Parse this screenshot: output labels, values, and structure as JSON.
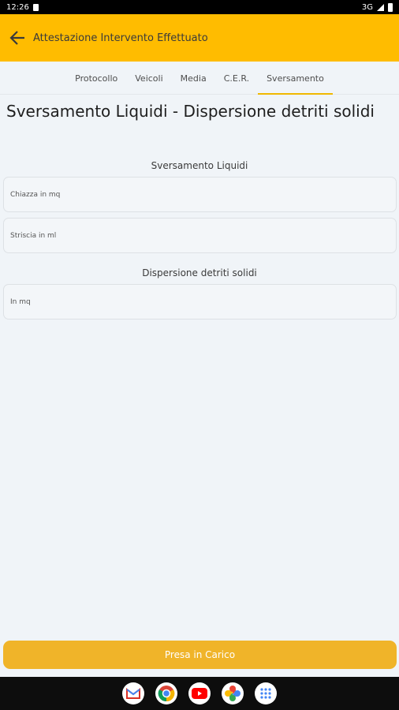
{
  "status_bar": {
    "time": "12:26",
    "network": "3G"
  },
  "app_bar": {
    "title": "Attestazione Intervento Effettuato"
  },
  "tabs": [
    {
      "label": "Protocollo",
      "active": false
    },
    {
      "label": "Veicoli",
      "active": false
    },
    {
      "label": "Media",
      "active": false
    },
    {
      "label": "C.E.R.",
      "active": false
    },
    {
      "label": "Sversamento",
      "active": true
    }
  ],
  "section": {
    "title": "Sversamento Liquidi -  Dispersione detriti solidi",
    "liquidi": {
      "label": "Sversamento Liquidi",
      "chiazza_placeholder": "Chiazza in mq",
      "striscia_placeholder": "Striscia in ml"
    },
    "detriti": {
      "label": "Dispersione detriti solidi",
      "mq_placeholder": "In mq"
    }
  },
  "actions": {
    "primary_label": "Presa in Carico"
  },
  "colors": {
    "accent": "#ffbc00",
    "button": "#f0b429",
    "background": "#f0f4f8"
  },
  "nav_apps": [
    "gmail-icon",
    "chrome-icon",
    "youtube-icon",
    "photos-icon",
    "app-drawer-icon"
  ]
}
